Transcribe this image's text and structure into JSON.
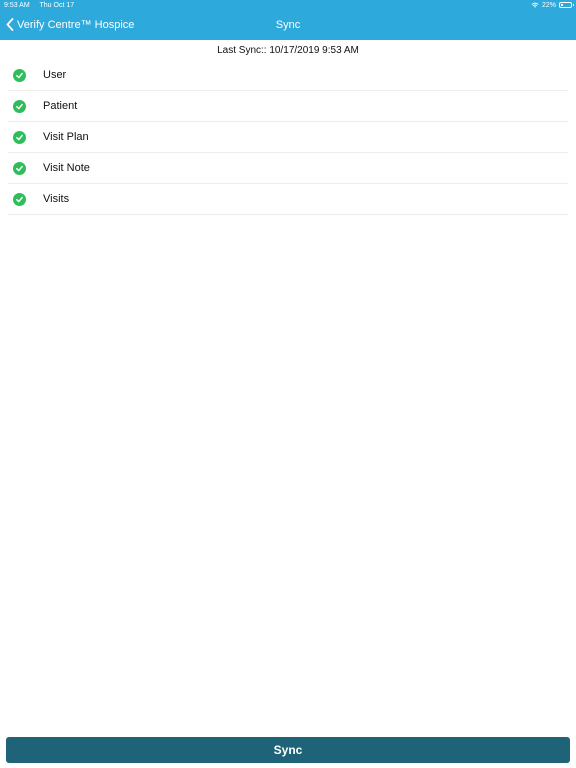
{
  "status_bar": {
    "time": "9:53 AM",
    "date": "Thu Oct 17",
    "battery_percent": "22%",
    "battery_level": 0.22
  },
  "nav": {
    "back_label": "Verify Centre™ Hospice",
    "title": "Sync"
  },
  "last_sync": "Last Sync:: 10/17/2019 9:53 AM",
  "items": [
    {
      "label": "User",
      "status": "complete"
    },
    {
      "label": "Patient",
      "status": "complete"
    },
    {
      "label": "Visit Plan",
      "status": "complete"
    },
    {
      "label": "Visit Note",
      "status": "complete"
    },
    {
      "label": "Visits",
      "status": "complete"
    }
  ],
  "sync_button": "Sync",
  "colors": {
    "accent": "#2ea9dc",
    "button": "#1e6378",
    "check": "#2fbd5b"
  }
}
